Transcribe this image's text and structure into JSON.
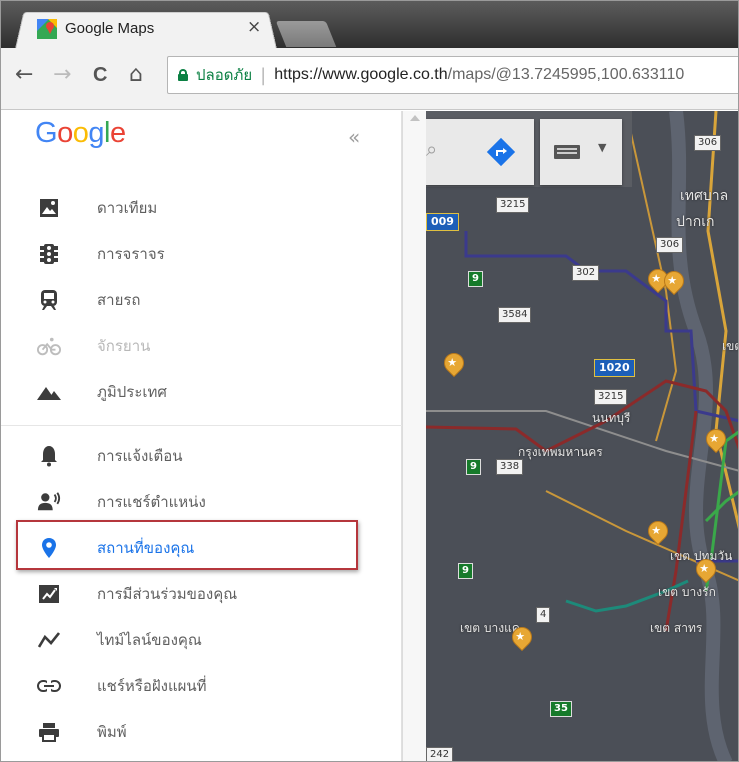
{
  "browser": {
    "tab_title": "Google Maps",
    "tab_close": "×",
    "nav": {
      "back": "←",
      "forward": "→",
      "reload": "C",
      "home": "⌂"
    },
    "secure_label": "ปลอดภัย",
    "url_host": "https://www.google.co.th",
    "url_path": "/maps/@13.7245995,100.633110"
  },
  "sidebar": {
    "logo_letters": [
      {
        "ch": "G",
        "color": "#4285F4"
      },
      {
        "ch": "o",
        "color": "#EA4335"
      },
      {
        "ch": "o",
        "color": "#FBBC05"
      },
      {
        "ch": "g",
        "color": "#4285F4"
      },
      {
        "ch": "l",
        "color": "#34A853"
      },
      {
        "ch": "e",
        "color": "#EA4335"
      }
    ],
    "collapse_label": "«",
    "group1": [
      {
        "label": "ดาวเทียม",
        "icon": "satellite-icon"
      },
      {
        "label": "การจราจร",
        "icon": "traffic-icon"
      },
      {
        "label": "สายรถ",
        "icon": "transit-icon"
      },
      {
        "label": "จักรยาน",
        "icon": "bicycle-icon",
        "disabled": true
      },
      {
        "label": "ภูมิประเทศ",
        "icon": "terrain-icon"
      }
    ],
    "group2": [
      {
        "label": "การแจ้งเตือน",
        "icon": "bell-icon"
      },
      {
        "label": "การแชร์ตำแหน่ง",
        "icon": "location-sharing-icon"
      },
      {
        "label": "สถานที่ของคุณ",
        "icon": "place-pin-icon",
        "active": true
      },
      {
        "label": "การมีส่วนร่วมของคุณ",
        "icon": "contributions-icon"
      },
      {
        "label": "ไทม์ไลน์ของคุณ",
        "icon": "timeline-icon"
      },
      {
        "label": "แชร์หรือฝังแผนที่",
        "icon": "link-icon"
      },
      {
        "label": "พิมพ์",
        "icon": "print-icon"
      }
    ]
  },
  "map": {
    "places": [
      "เทศบาล",
      "ปากเก",
      "นนทบุรี",
      "กรุงเทพมหานคร",
      "เขต บางแค",
      "เขต สาทร",
      "เขต ปทุมวัน",
      "เขต บางรัก",
      "เขต"
    ],
    "highways": [
      "306",
      "3215",
      "306",
      "302",
      "9",
      "3584",
      "1020",
      "3215",
      "9",
      "338",
      "9",
      "4",
      "35",
      "242",
      "009"
    ],
    "colors": {
      "blue_line": "#3b3a8c",
      "red_line": "#8b2a2a",
      "green_line": "#3aa84a",
      "teal_line": "#1d8a7a",
      "road": "#d9a53a"
    }
  }
}
